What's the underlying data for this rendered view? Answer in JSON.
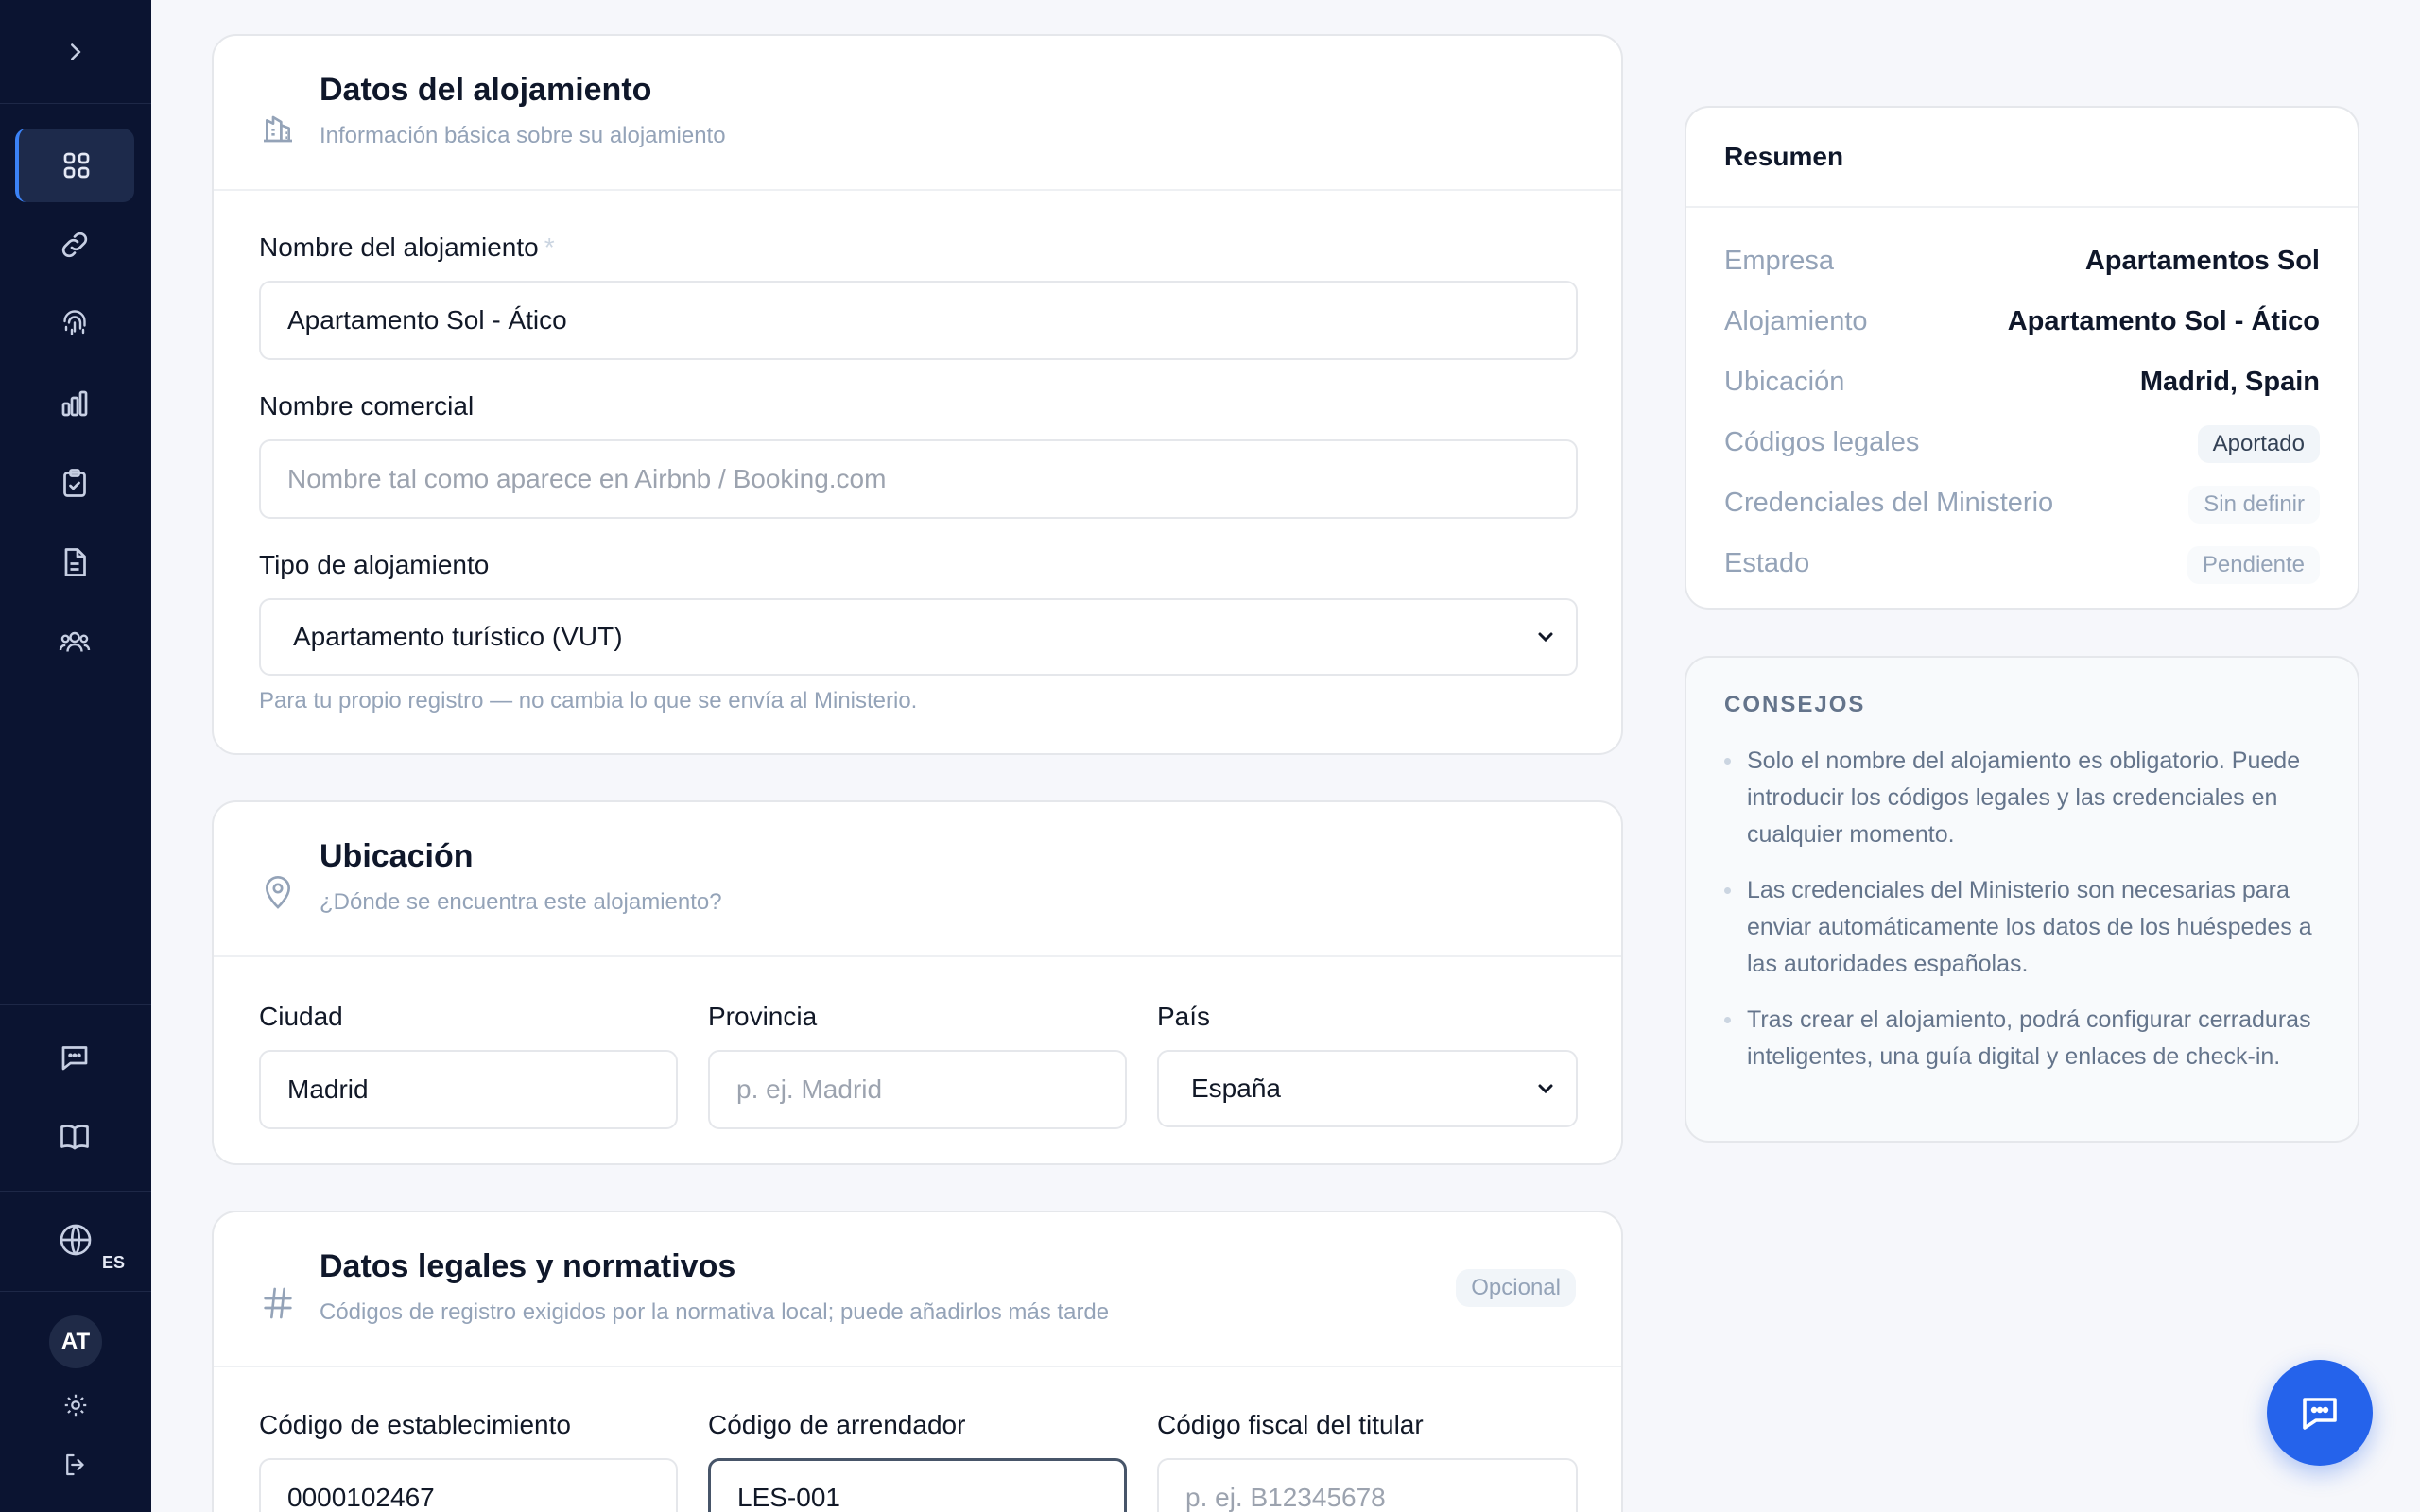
{
  "sidebar": {
    "language": "ES",
    "user_initials": "AT"
  },
  "alojamiento": {
    "title": "Datos del alojamiento",
    "subtitle": "Información básica sobre su alojamiento",
    "name_label": "Nombre del alojamiento",
    "required_mark": "*",
    "name_value": "Apartamento Sol - Ático",
    "commercial_label": "Nombre comercial",
    "commercial_placeholder": "Nombre tal como aparece en Airbnb / Booking.com",
    "type_label": "Tipo de alojamiento",
    "type_value": "Apartamento turístico (VUT)",
    "type_hint": "Para tu propio registro — no cambia lo que se envía al Ministerio."
  },
  "ubicacion": {
    "title": "Ubicación",
    "subtitle": "¿Dónde se encuentra este alojamiento?",
    "city_label": "Ciudad",
    "city_value": "Madrid",
    "province_label": "Provincia",
    "province_placeholder": "p. ej. Madrid",
    "country_label": "País",
    "country_value": "España"
  },
  "legal": {
    "title": "Datos legales y normativos",
    "subtitle": "Códigos de registro exigidos por la normativa local; puede añadirlos más tarde",
    "optional_badge": "Opcional",
    "establishment_label": "Código de establecimiento",
    "establishment_value": "0000102467",
    "landlord_label": "Código de arrendador",
    "landlord_value": "LES-001",
    "tax_label": "Código fiscal del titular",
    "tax_placeholder": "p. ej. B12345678"
  },
  "summary": {
    "title": "Resumen",
    "rows": [
      {
        "key": "Empresa",
        "value": "Apartamentos Sol"
      },
      {
        "key": "Alojamiento",
        "value": "Apartamento Sol - Ático"
      },
      {
        "key": "Ubicación",
        "value": "Madrid, Spain"
      },
      {
        "key": "Códigos legales",
        "value": "Aportado"
      },
      {
        "key": "Credenciales del Ministerio",
        "value": "Sin definir"
      },
      {
        "key": "Estado",
        "value": "Pendiente"
      }
    ]
  },
  "tips": {
    "title": "CONSEJOS",
    "items": [
      "Solo el nombre del alojamiento es obligatorio. Puede introducir los códigos legales y las credenciales en cualquier momento.",
      "Las credenciales del Ministerio son necesarias para enviar automáticamente los datos de los huéspedes a las autoridades españolas.",
      "Tras crear el alojamiento, podrá configurar cerraduras inteligentes, una guía digital y enlaces de check-in."
    ]
  },
  "colors": {
    "sidebar_bg": "#0b1431",
    "accent": "#2563eb"
  }
}
